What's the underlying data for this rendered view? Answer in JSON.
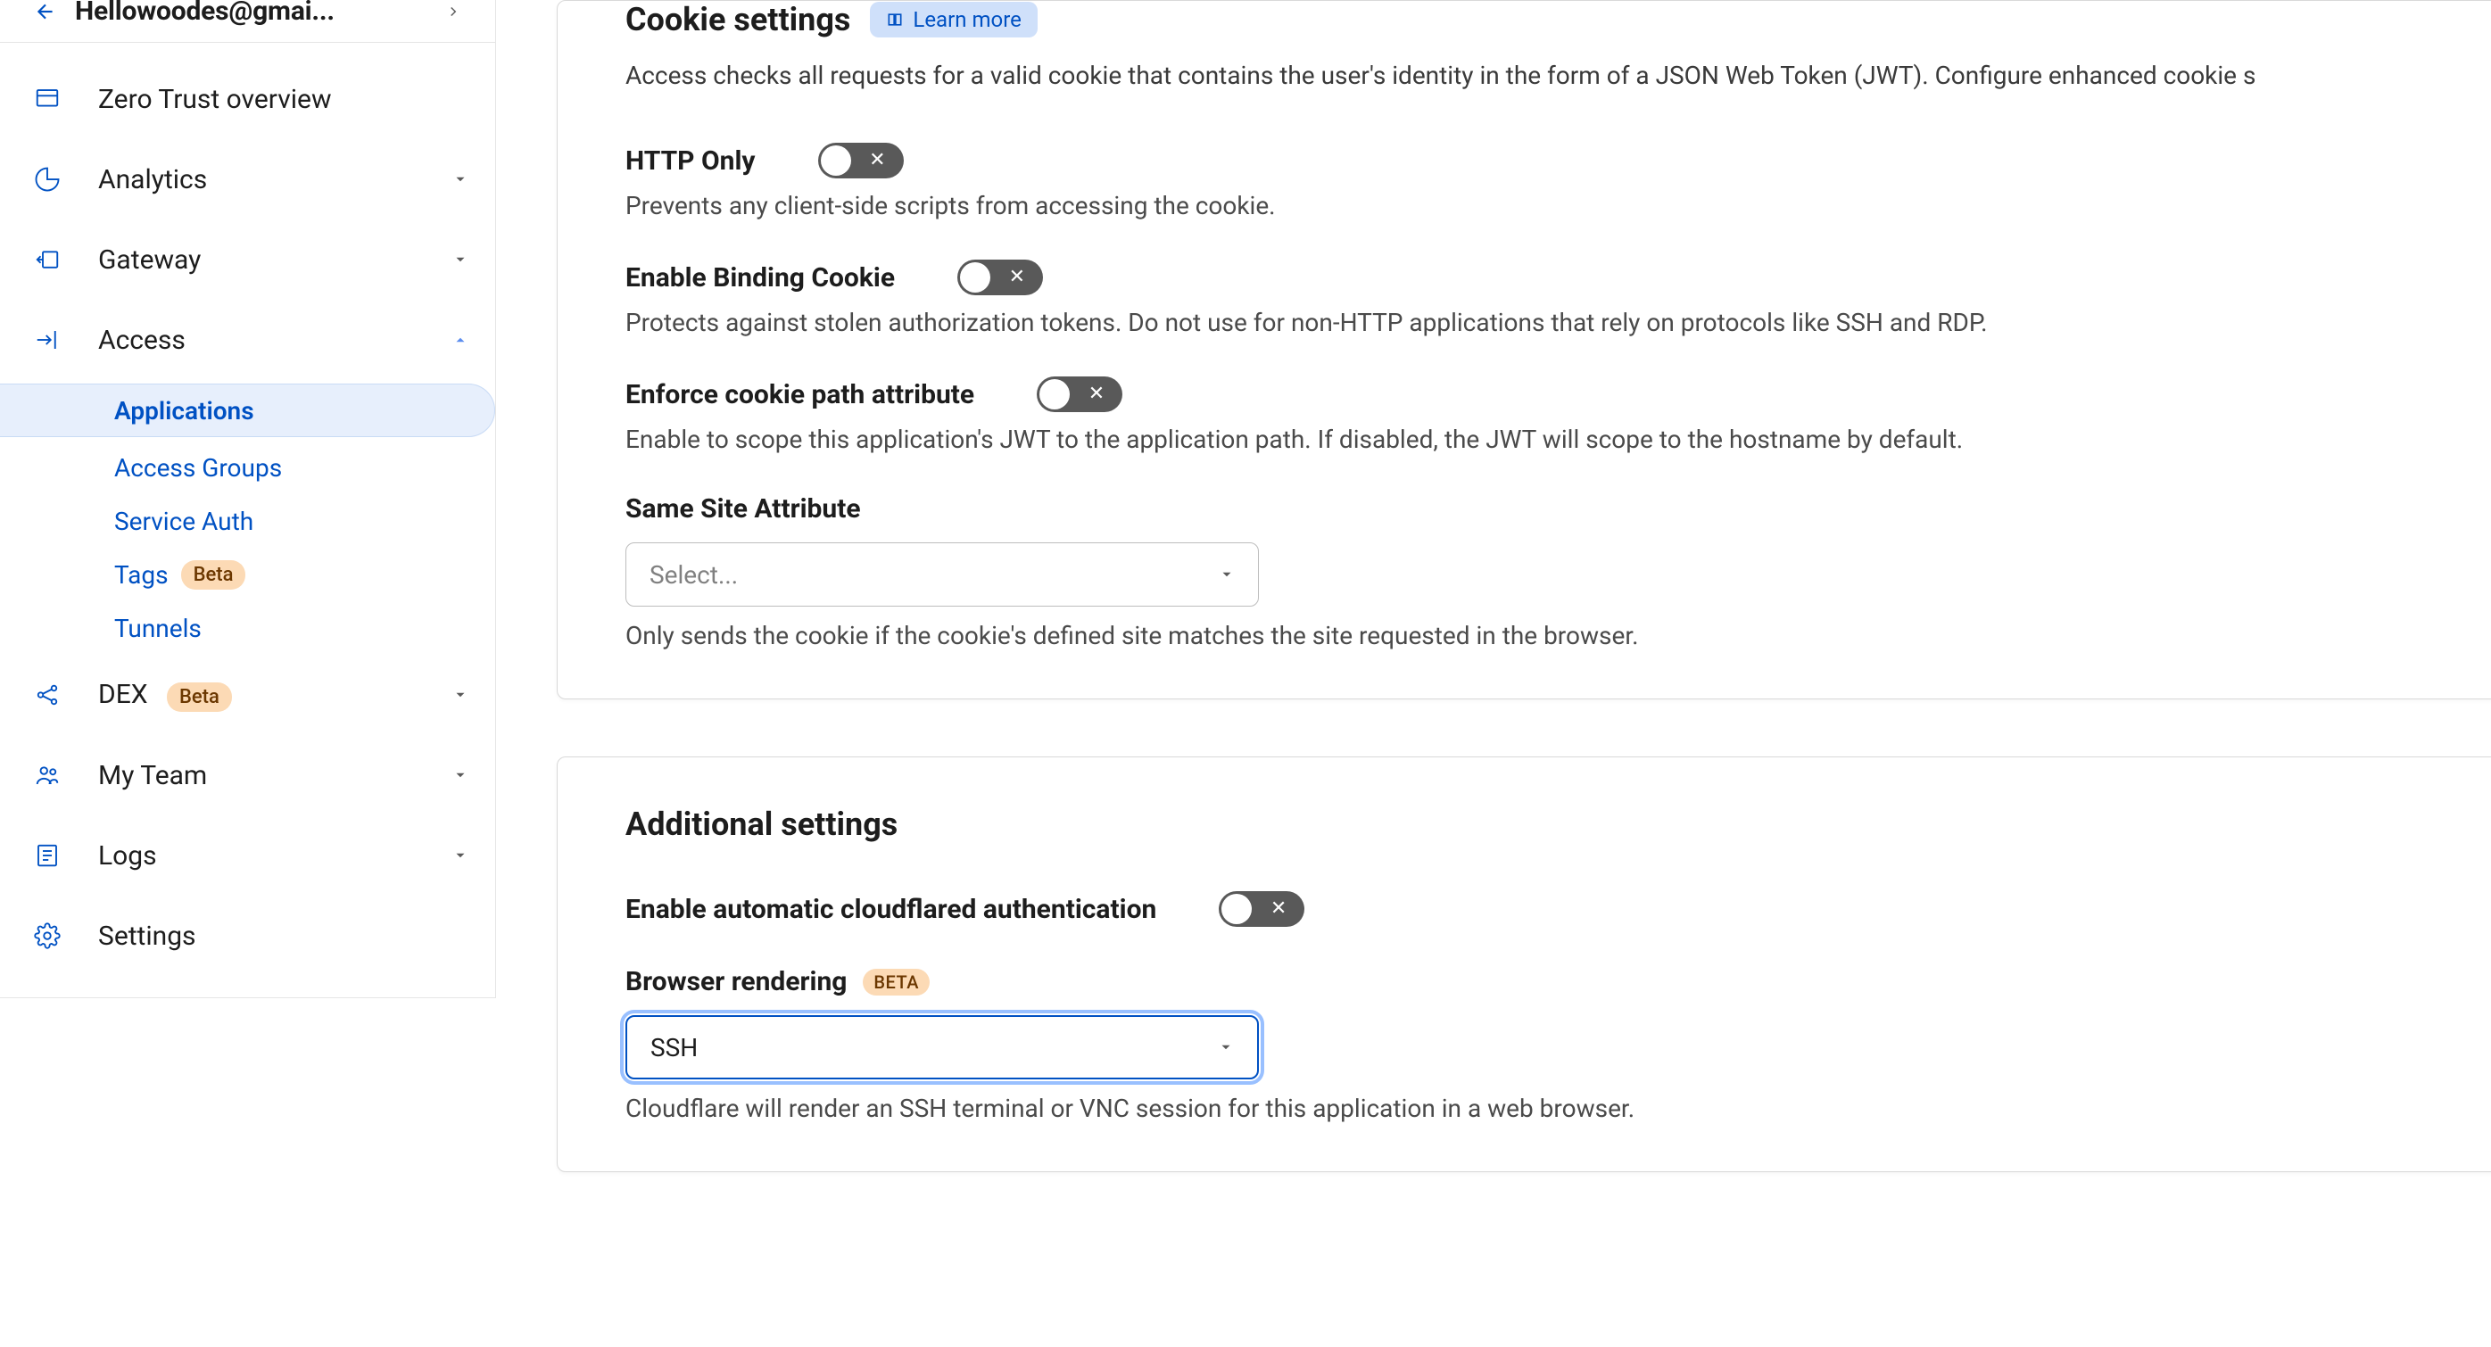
{
  "account": {
    "email": "Hellowoodes@gmai..."
  },
  "sidebar": {
    "items": [
      {
        "label": "Zero Trust overview",
        "icon": "dashboard",
        "expandable": false
      },
      {
        "label": "Analytics",
        "icon": "pie",
        "expandable": true
      },
      {
        "label": "Gateway",
        "icon": "gateway",
        "expandable": true
      },
      {
        "label": "Access",
        "icon": "access",
        "expandable": true,
        "expanded": true,
        "children": [
          {
            "label": "Applications",
            "active": true
          },
          {
            "label": "Access Groups"
          },
          {
            "label": "Service Auth"
          },
          {
            "label": "Tags",
            "badge": "Beta"
          },
          {
            "label": "Tunnels"
          }
        ]
      },
      {
        "label": "DEX",
        "icon": "dex",
        "badge": "Beta",
        "expandable": true
      },
      {
        "label": "My Team",
        "icon": "team",
        "expandable": true
      },
      {
        "label": "Logs",
        "icon": "logs",
        "expandable": true
      },
      {
        "label": "Settings",
        "icon": "settings",
        "expandable": false
      }
    ]
  },
  "cookie_section": {
    "title": "Cookie settings",
    "learn_more": "Learn more",
    "description": "Access checks all requests for a valid cookie that contains the user's identity in the form of a JSON Web Token (JWT). Configure enhanced cookie s",
    "settings": {
      "http_only": {
        "label": "HTTP Only",
        "desc": "Prevents any client-side scripts from accessing the cookie."
      },
      "binding": {
        "label": "Enable Binding Cookie",
        "desc": "Protects against stolen authorization tokens. Do not use for non-HTTP applications that rely on protocols like SSH and RDP."
      },
      "path": {
        "label": "Enforce cookie path attribute",
        "desc": "Enable to scope this application's JWT to the application path. If disabled, the JWT will scope to the hostname by default."
      },
      "samesite": {
        "label": "Same Site Attribute",
        "placeholder": "Select...",
        "desc": "Only sends the cookie if the cookie's defined site matches the site requested in the browser."
      }
    }
  },
  "additional_section": {
    "title": "Additional settings",
    "settings": {
      "auto_cf": {
        "label": "Enable automatic cloudflared authentication"
      },
      "browser_rendering": {
        "label": "Browser rendering",
        "badge": "BETA",
        "value": "SSH",
        "desc": "Cloudflare will render an SSH terminal or VNC session for this application in a web browser."
      }
    }
  }
}
